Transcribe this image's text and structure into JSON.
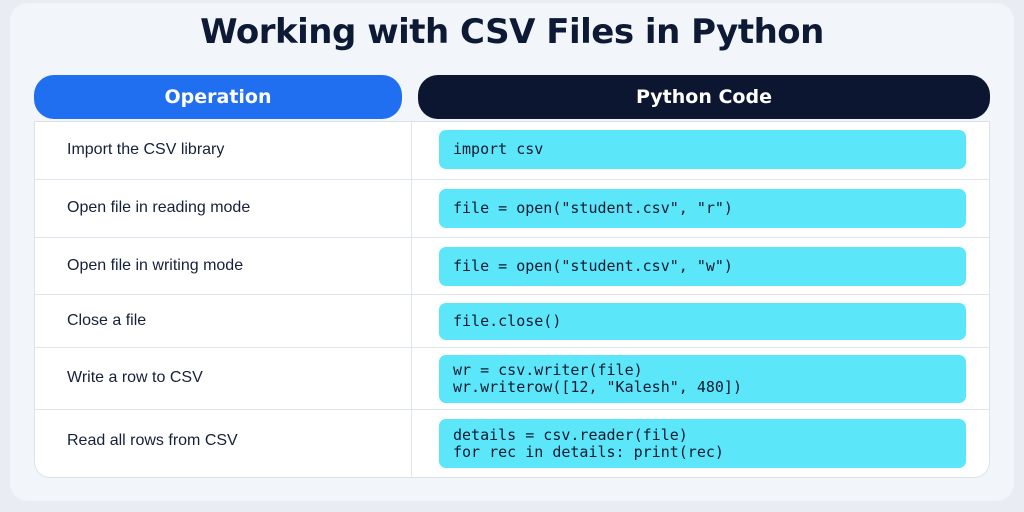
{
  "title": "Working with CSV Files in Python",
  "headers": {
    "operation": "Operation",
    "code": "Python Code"
  },
  "rows": [
    {
      "operation": "Import the CSV library",
      "code": [
        "import csv"
      ]
    },
    {
      "operation": "Open file in reading mode",
      "code": [
        "file = open(\"student.csv\", \"r\")"
      ]
    },
    {
      "operation": "Open file in writing mode",
      "code": [
        "file = open(\"student.csv\", \"w\")"
      ]
    },
    {
      "operation": "Close a file",
      "code": [
        "file.close()"
      ]
    },
    {
      "operation": "Write a row to CSV",
      "code": [
        "wr = csv.writer(file)",
        "wr.writerow([12, \"Kalesh\", 480])"
      ]
    },
    {
      "operation": "Read all rows from CSV",
      "code": [
        "details = csv.reader(file)",
        "for rec in details: print(rec)"
      ]
    }
  ],
  "colors": {
    "operation_header": "#1f6ff0",
    "code_header": "#0c1631",
    "code_box": "#5ce6fa",
    "title": "#0d1a35"
  }
}
